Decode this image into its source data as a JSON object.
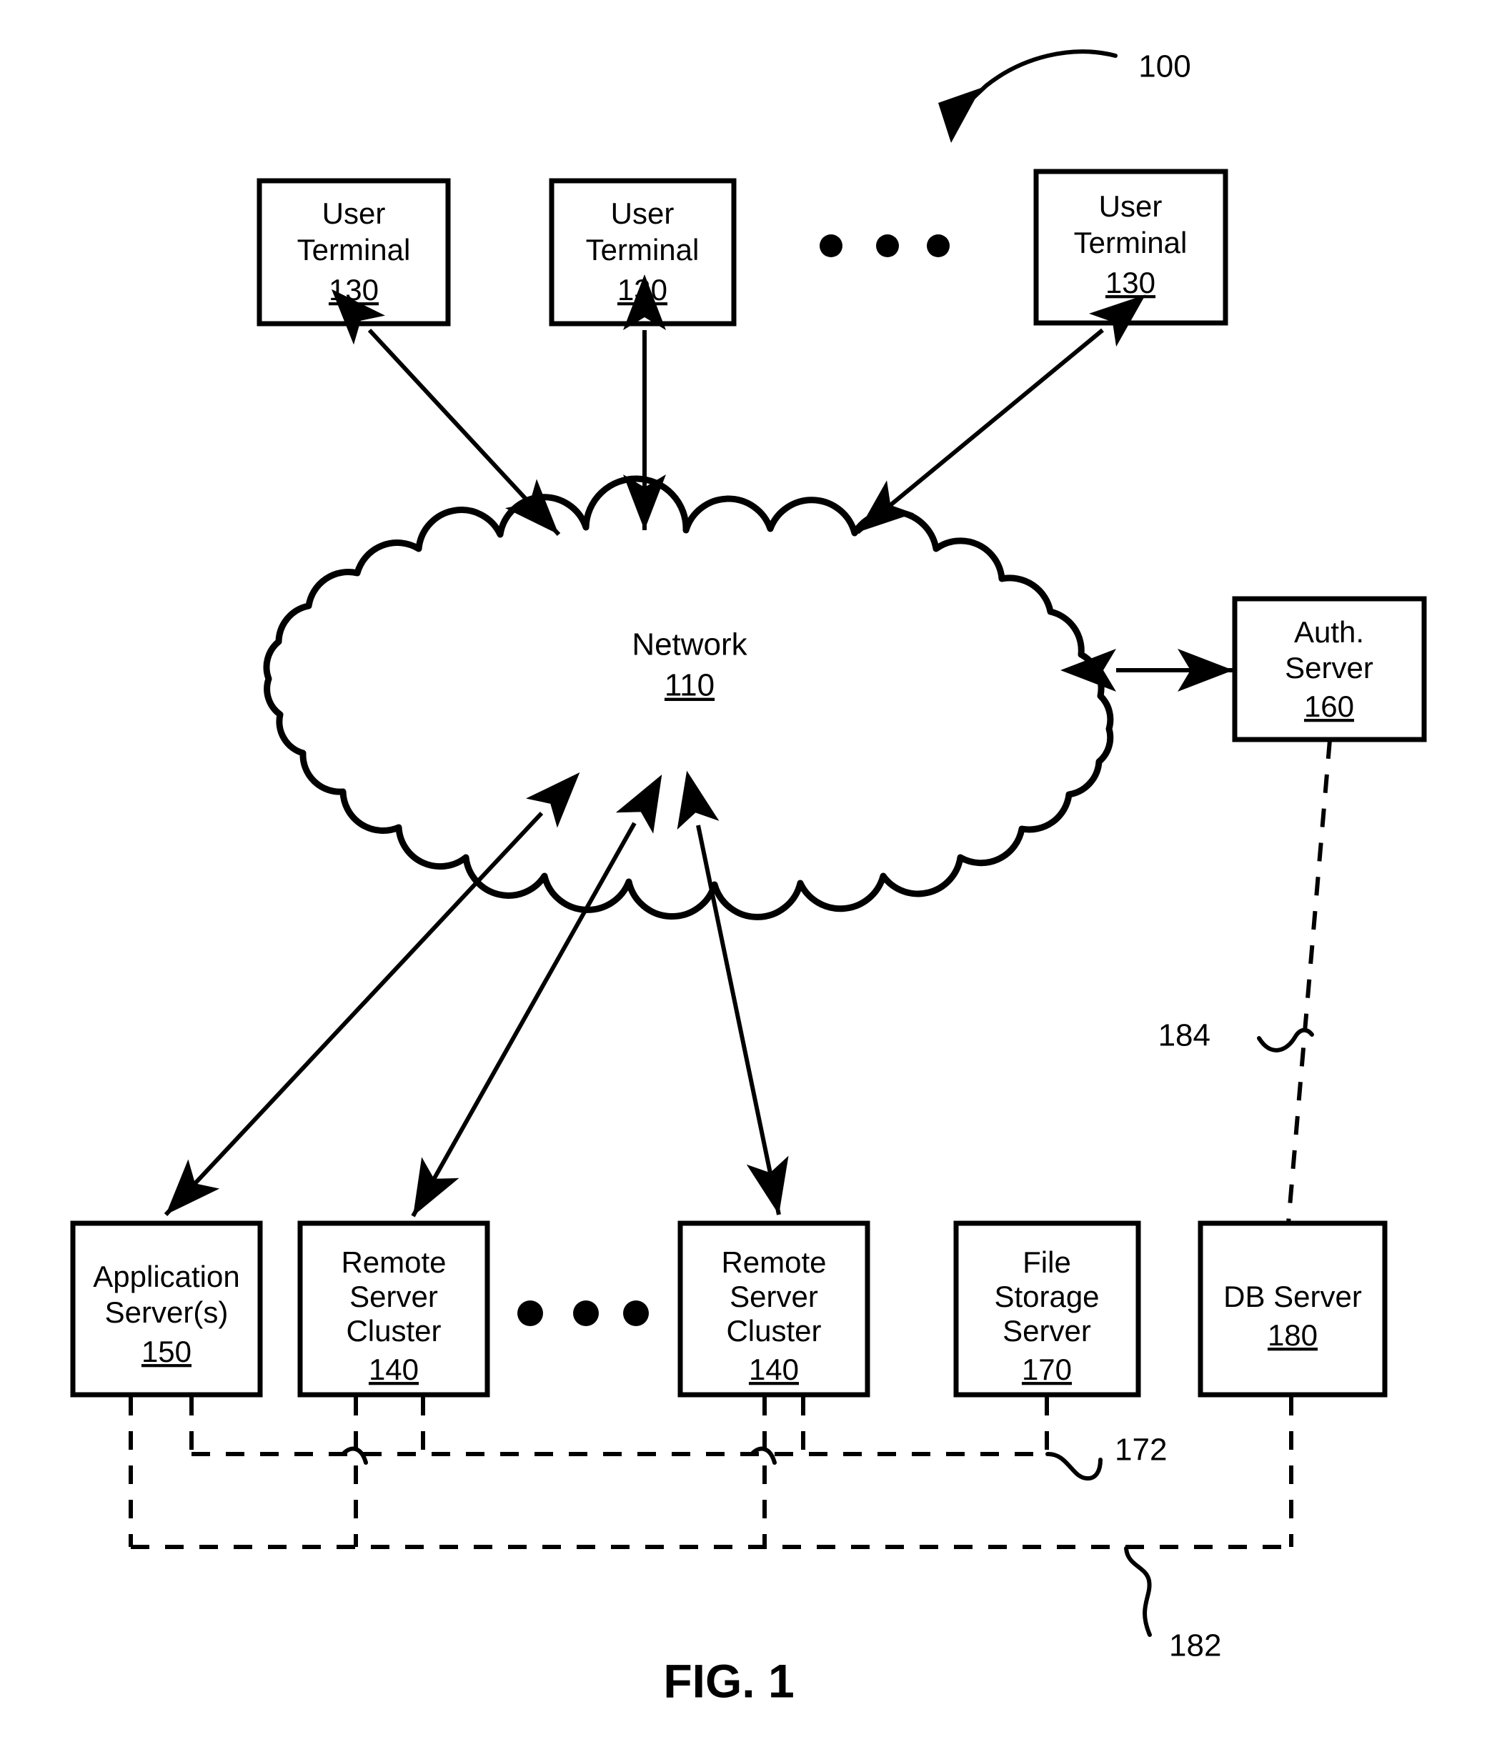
{
  "figure": {
    "caption": "FIG. 1",
    "system_ref": "100"
  },
  "nodes": {
    "user_terminal_1": {
      "line1": "User",
      "line2": "Terminal",
      "ref": "130"
    },
    "user_terminal_2": {
      "line1": "User",
      "line2": "Terminal",
      "ref": "130"
    },
    "user_terminal_3": {
      "line1": "User",
      "line2": "Terminal",
      "ref": "130"
    },
    "network": {
      "line1": "Network",
      "ref": "110"
    },
    "auth_server": {
      "line1": "Auth.",
      "line2": "Server",
      "ref": "160"
    },
    "application_server": {
      "line1": "Application",
      "line2": "Server(s)",
      "ref": "150"
    },
    "remote_server_cluster_1": {
      "line1": "Remote",
      "line2": "Server",
      "line3": "Cluster",
      "ref": "140"
    },
    "remote_server_cluster_2": {
      "line1": "Remote",
      "line2": "Server",
      "line3": "Cluster",
      "ref": "140"
    },
    "file_storage_server": {
      "line1": "File",
      "line2": "Storage",
      "line3": "Server",
      "ref": "170"
    },
    "db_server": {
      "line1": "DB Server",
      "ref": "180"
    }
  },
  "connection_labels": {
    "file_bus": "172",
    "db_bus": "182",
    "auth_db_link": "184"
  },
  "colors": {
    "ink": "#000000",
    "paper": "#ffffff"
  }
}
